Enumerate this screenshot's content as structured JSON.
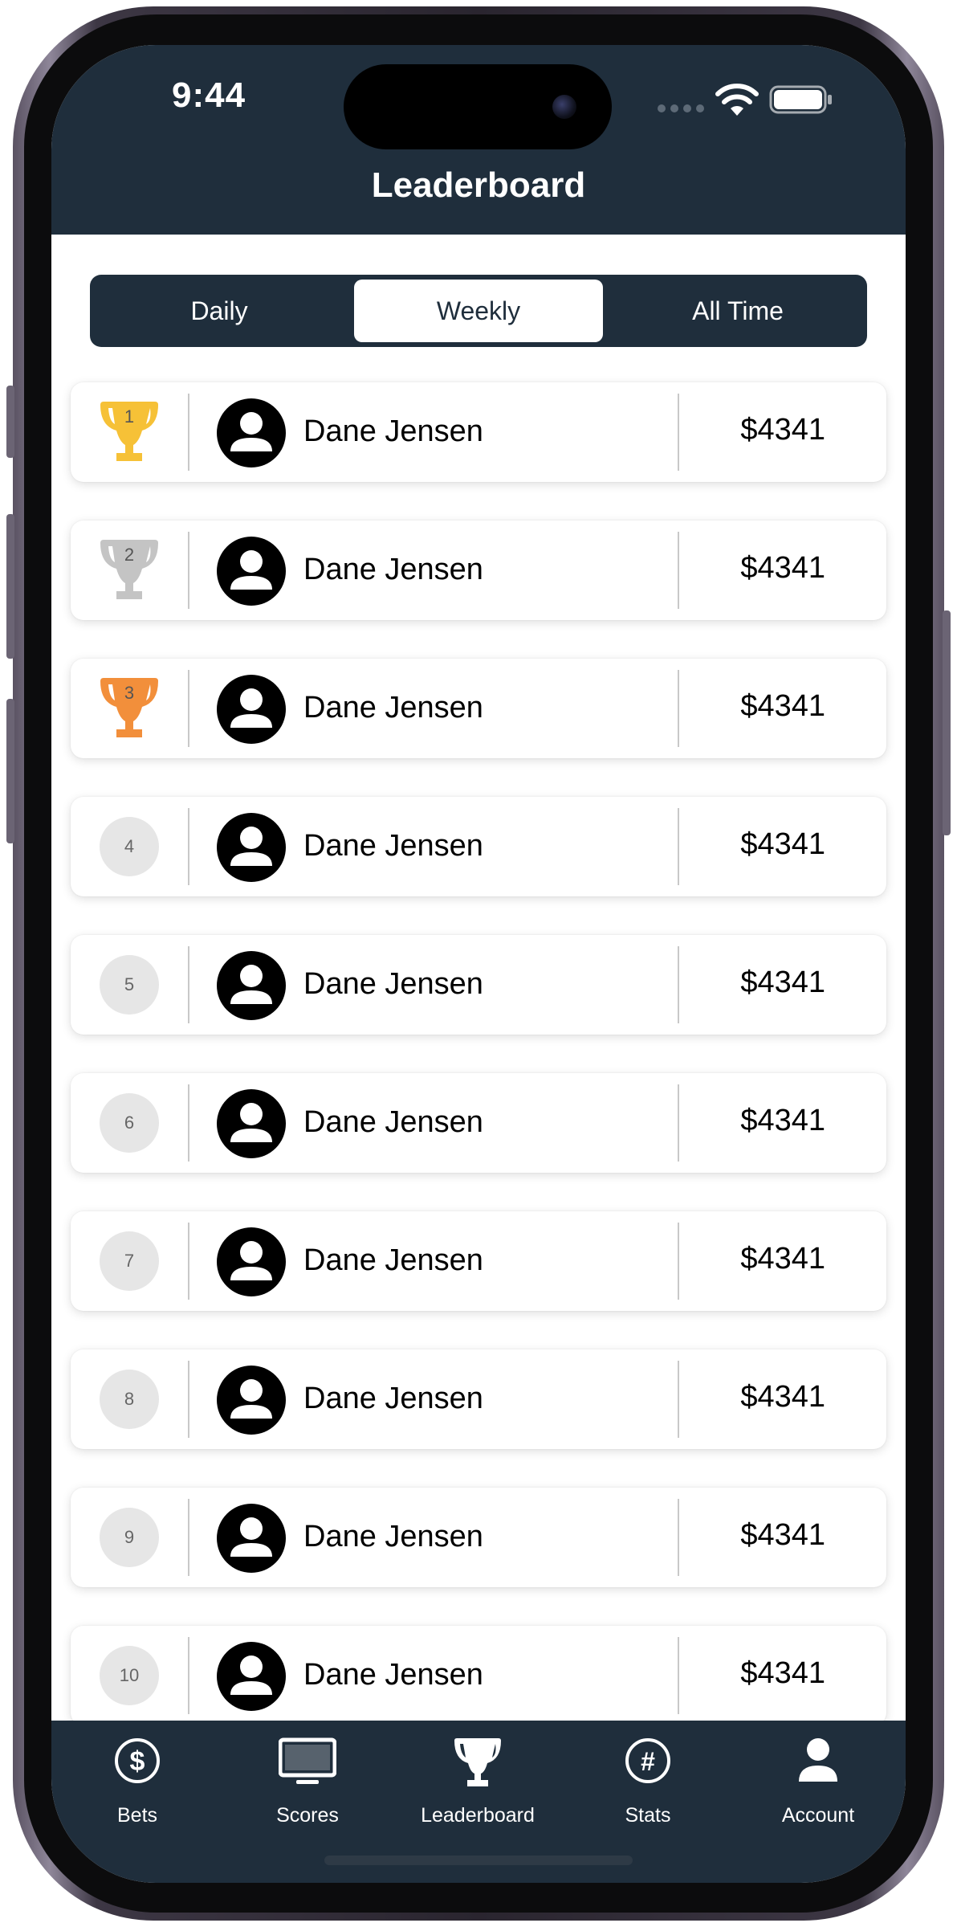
{
  "status_bar": {
    "time": "9:44"
  },
  "header": {
    "title": "Leaderboard"
  },
  "segments": [
    {
      "label": "Daily",
      "active": false
    },
    {
      "label": "Weekly",
      "active": true
    },
    {
      "label": "All Time",
      "active": false
    }
  ],
  "rows": [
    {
      "rank": "1",
      "name": "Dane Jensen",
      "score": "$4341",
      "badge": "trophy-gold"
    },
    {
      "rank": "2",
      "name": "Dane Jensen",
      "score": "$4341",
      "badge": "trophy-silver"
    },
    {
      "rank": "3",
      "name": "Dane Jensen",
      "score": "$4341",
      "badge": "trophy-bronze"
    },
    {
      "rank": "4",
      "name": "Dane Jensen",
      "score": "$4341",
      "badge": "circle"
    },
    {
      "rank": "5",
      "name": "Dane Jensen",
      "score": "$4341",
      "badge": "circle"
    },
    {
      "rank": "6",
      "name": "Dane Jensen",
      "score": "$4341",
      "badge": "circle"
    },
    {
      "rank": "7",
      "name": "Dane Jensen",
      "score": "$4341",
      "badge": "circle"
    },
    {
      "rank": "8",
      "name": "Dane Jensen",
      "score": "$4341",
      "badge": "circle"
    },
    {
      "rank": "9",
      "name": "Dane Jensen",
      "score": "$4341",
      "badge": "circle"
    },
    {
      "rank": "10",
      "name": "Dane Jensen",
      "score": "$4341",
      "badge": "circle"
    }
  ],
  "tab_bar": [
    {
      "label": "Bets",
      "icon": "dollar-circle-icon"
    },
    {
      "label": "Scores",
      "icon": "monitor-icon"
    },
    {
      "label": "Leaderboard",
      "icon": "trophy-icon"
    },
    {
      "label": "Stats",
      "icon": "hashtag-circle-icon"
    },
    {
      "label": "Account",
      "icon": "person-icon"
    }
  ],
  "colors": {
    "navy": "#1f2e3c",
    "gold": "#f6c137",
    "silver": "#c4c4c4",
    "bronze": "#f28f3b",
    "rank_circle": "#e6e6e6"
  }
}
